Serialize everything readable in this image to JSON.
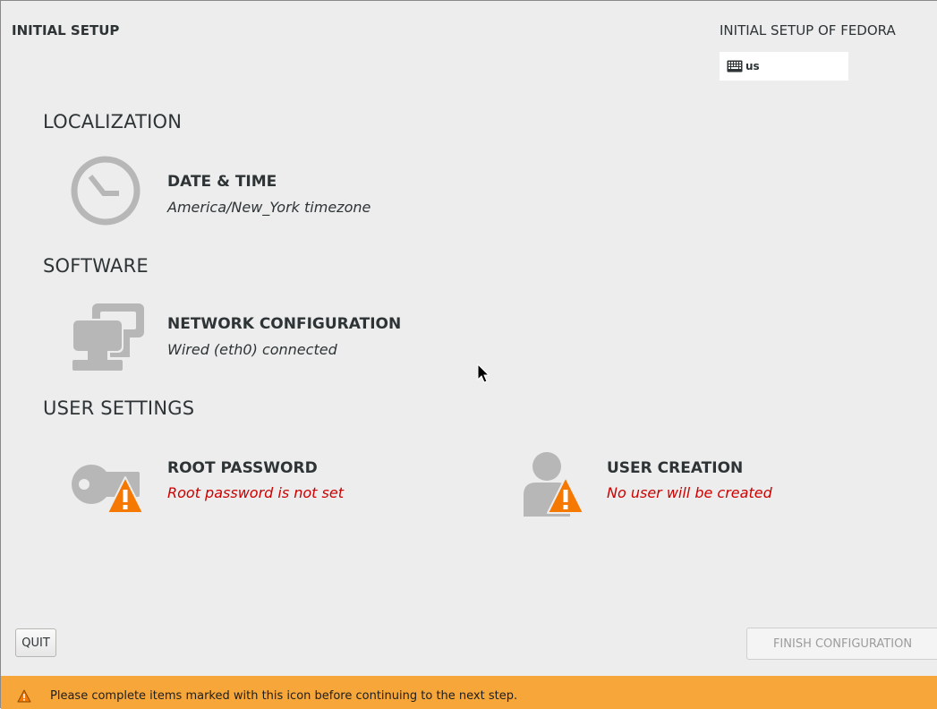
{
  "header": {
    "app_title": "INITIAL SETUP",
    "product_title": "INITIAL SETUP OF FEDORA",
    "keyboard_layout": "us",
    "keyboard_icon": "keyboard-icon"
  },
  "categories": [
    {
      "title": "LOCALIZATION",
      "spokes": [
        {
          "title": "DATE & TIME",
          "status": "America/New_York timezone",
          "icon": "clock-icon",
          "warning": false
        }
      ]
    },
    {
      "title": "SOFTWARE",
      "spokes": [
        {
          "title": "NETWORK CONFIGURATION",
          "status": "Wired (eth0) connected",
          "icon": "network-icon",
          "warning": false
        }
      ]
    },
    {
      "title": "USER SETTINGS",
      "spokes": [
        {
          "title": "ROOT PASSWORD",
          "status": "Root password is not set",
          "icon": "key-icon",
          "warning": true
        },
        {
          "title": "USER CREATION",
          "status": "No user will be created",
          "icon": "user-icon",
          "warning": true
        }
      ]
    }
  ],
  "buttons": {
    "quit_label": "QUIT",
    "finish_label": "FINISH CONFIGURATION"
  },
  "warning_bar": {
    "icon": "warning-icon",
    "text": "Please complete items marked with this icon before continuing to the next step."
  },
  "colors": {
    "background": "#ededed",
    "warning_bar": "#f7a73a",
    "warning_text": "#cc0000",
    "icon_gray": "#b7b7b7",
    "warning_triangle": "#f57900"
  }
}
